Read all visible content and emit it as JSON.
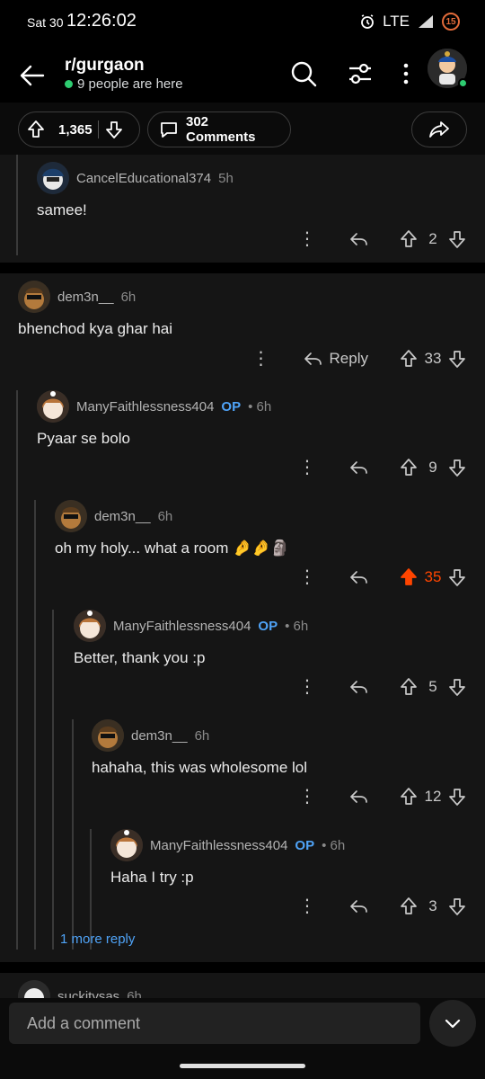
{
  "status": {
    "date": "Sat 30",
    "time": "12:26:02",
    "network": "LTE",
    "badge": "15"
  },
  "header": {
    "subreddit": "r/gurgaon",
    "online": "9 people are here"
  },
  "post_actions": {
    "score": "1,365",
    "comments": "302 Comments"
  },
  "comments": [
    {
      "user": "CancelEducational374",
      "op": "",
      "time": "5h",
      "text": "samee!",
      "reply_label": "",
      "score": "2"
    },
    {
      "user": "dem3n__",
      "op": "",
      "time": "6h",
      "text": "bhenchod kya ghar hai",
      "reply_label": "Reply",
      "score": "33"
    },
    {
      "user": "ManyFaithlessness404",
      "op": "OP",
      "time": "• 6h",
      "text": "Pyaar se bolo",
      "reply_label": "",
      "score": "9"
    },
    {
      "user": "dem3n__",
      "op": "",
      "time": "6h",
      "text": "oh my holy... what a room 🤌🤌🗿",
      "reply_label": "",
      "score": "35"
    },
    {
      "user": "ManyFaithlessness404",
      "op": "OP",
      "time": "• 6h",
      "text": "Better, thank you :p",
      "reply_label": "",
      "score": "5"
    },
    {
      "user": "dem3n__",
      "op": "",
      "time": "6h",
      "text": "hahaha, this was wholesome lol",
      "reply_label": "",
      "score": "12"
    },
    {
      "user": "ManyFaithlessness404",
      "op": "OP",
      "time": "• 6h",
      "text": "Haha I try :p",
      "reply_label": "",
      "score": "3"
    }
  ],
  "more_reply": "1 more reply",
  "partial_next": {
    "user": "suckitysas",
    "time": "6h"
  },
  "composer": {
    "placeholder": "Add a comment"
  },
  "colors": {
    "upvoted": "#ff4500",
    "op": "#4fa3f7",
    "background": "#151515"
  }
}
